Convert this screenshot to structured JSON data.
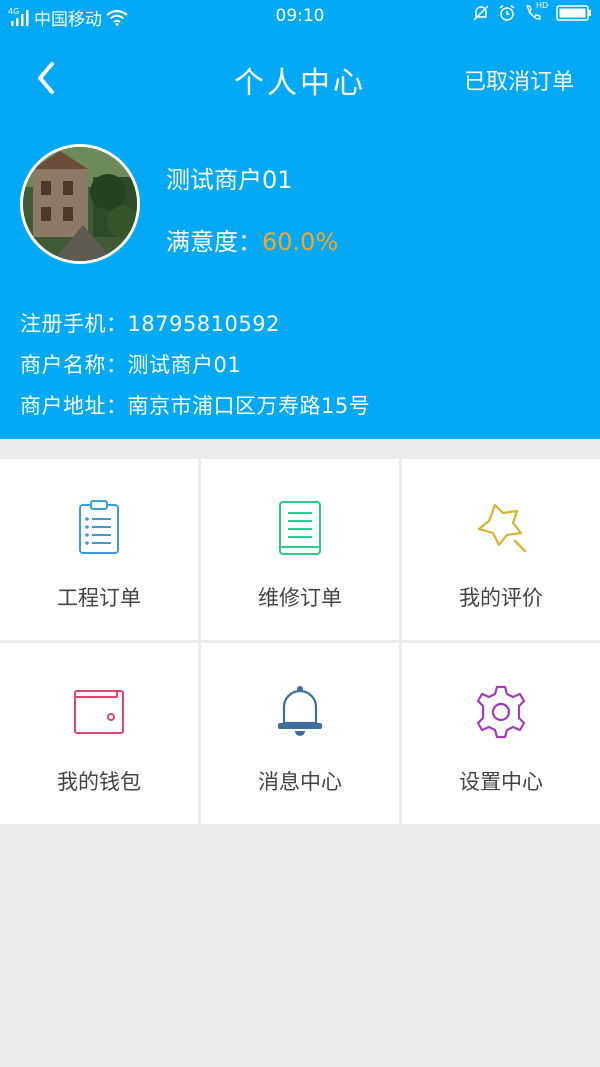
{
  "status": {
    "carrier": "中国移动",
    "signal_tag": "4G",
    "time": "09:10",
    "hd_tag": "HD"
  },
  "header": {
    "title": "个人中心",
    "right_action": "已取消订单"
  },
  "profile": {
    "name": "测试商户01",
    "satisfaction_label": "满意度：",
    "satisfaction_value": "60.0%"
  },
  "info": {
    "phone_label": "注册手机：",
    "phone_value": "18795810592",
    "merchant_label": "商户名称：",
    "merchant_value": "测试商户01",
    "address_label": "商户地址：",
    "address_value": "南京市浦口区万寿路15号"
  },
  "menu": [
    {
      "label": "工程订单",
      "icon": "clipboard-list-icon",
      "color": "#3b9dd9"
    },
    {
      "label": "维修订单",
      "icon": "document-lines-icon",
      "color": "#2ecc8a"
    },
    {
      "label": "我的评价",
      "icon": "star-search-icon",
      "color": "#d4b52c"
    },
    {
      "label": "我的钱包",
      "icon": "wallet-icon",
      "color": "#e0466a"
    },
    {
      "label": "消息中心",
      "icon": "bell-icon",
      "color": "#3d6e9e"
    },
    {
      "label": "设置中心",
      "icon": "gear-icon",
      "color": "#a23bb5"
    }
  ],
  "colors": {
    "primary": "#03a9f4",
    "accent": "#f5a623",
    "background": "#ececec"
  }
}
